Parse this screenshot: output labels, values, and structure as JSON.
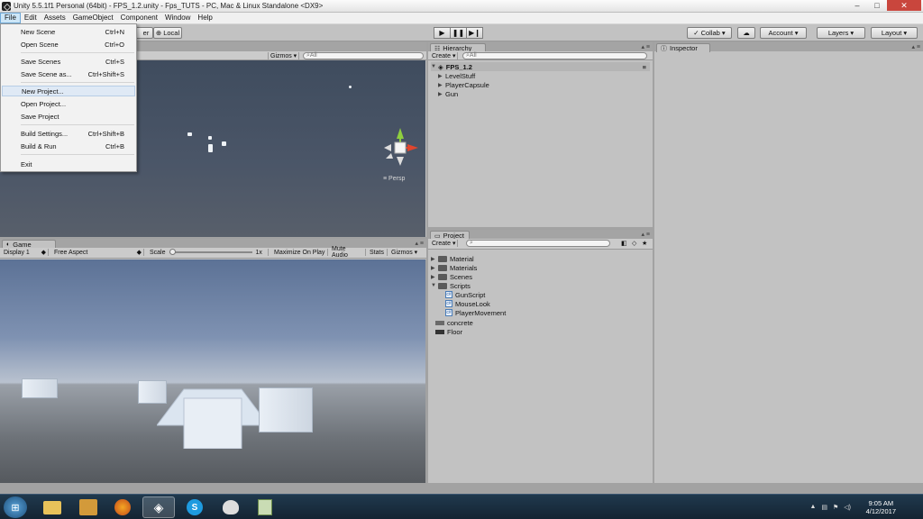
{
  "window": {
    "title": "Unity 5.5.1f1 Personal (64bit) - FPS_1.2.unity - Fps_TUTS - PC, Mac & Linux Standalone <DX9>",
    "minimize": "–",
    "maximize": "□",
    "close": "✕"
  },
  "menubar": [
    "File",
    "Edit",
    "Assets",
    "GameObject",
    "Component",
    "Window",
    "Help"
  ],
  "file_menu": {
    "items": [
      {
        "label": "New Scene",
        "shortcut": "Ctrl+N"
      },
      {
        "label": "Open Scene",
        "shortcut": "Ctrl+O"
      },
      {
        "label": "Save Scenes",
        "shortcut": "Ctrl+S"
      },
      {
        "label": "Save Scene as...",
        "shortcut": "Ctrl+Shift+S"
      },
      {
        "label": "New Project...",
        "shortcut": ""
      },
      {
        "label": "Open Project...",
        "shortcut": ""
      },
      {
        "label": "Save Project",
        "shortcut": ""
      },
      {
        "label": "Build Settings...",
        "shortcut": "Ctrl+Shift+B"
      },
      {
        "label": "Build & Run",
        "shortcut": "Ctrl+B"
      },
      {
        "label": "Exit",
        "shortcut": ""
      }
    ]
  },
  "toolbar": {
    "pivot_partial": "er",
    "local": "Local",
    "collab": "Collab ▾",
    "account": "Account ▾",
    "layers": "Layers ▾",
    "layout": "Layout ▾"
  },
  "scene": {
    "gizmos": "Gizmos ▾",
    "search": "⌕All",
    "persp": "Persp"
  },
  "game": {
    "tab": "Game",
    "display": "Display 1",
    "aspect": "Free Aspect",
    "scale_label": "Scale",
    "scale_value": "1x",
    "maximize": "Maximize On Play",
    "mute": "Mute Audio",
    "stats": "Stats",
    "gizmos": "Gizmos ▾"
  },
  "hierarchy": {
    "tab": "Hierarchy",
    "create": "Create ▾",
    "search": "⌕All",
    "scene_name": "FPS_1.2",
    "items": [
      "LevelStuff",
      "PlayerCapsule",
      "Gun"
    ]
  },
  "project": {
    "tab": "Project",
    "create": "Create ▾",
    "folders": [
      "Material",
      "Materials",
      "Scenes",
      "Scripts"
    ],
    "scripts": [
      "GunScript",
      "MouseLook",
      "PlayerMovement"
    ],
    "assets": [
      "concrete",
      "Floor"
    ]
  },
  "inspector": {
    "tab": "Inspector"
  },
  "taskbar": {
    "time": "9:05 AM",
    "date": "4/12/2017"
  }
}
